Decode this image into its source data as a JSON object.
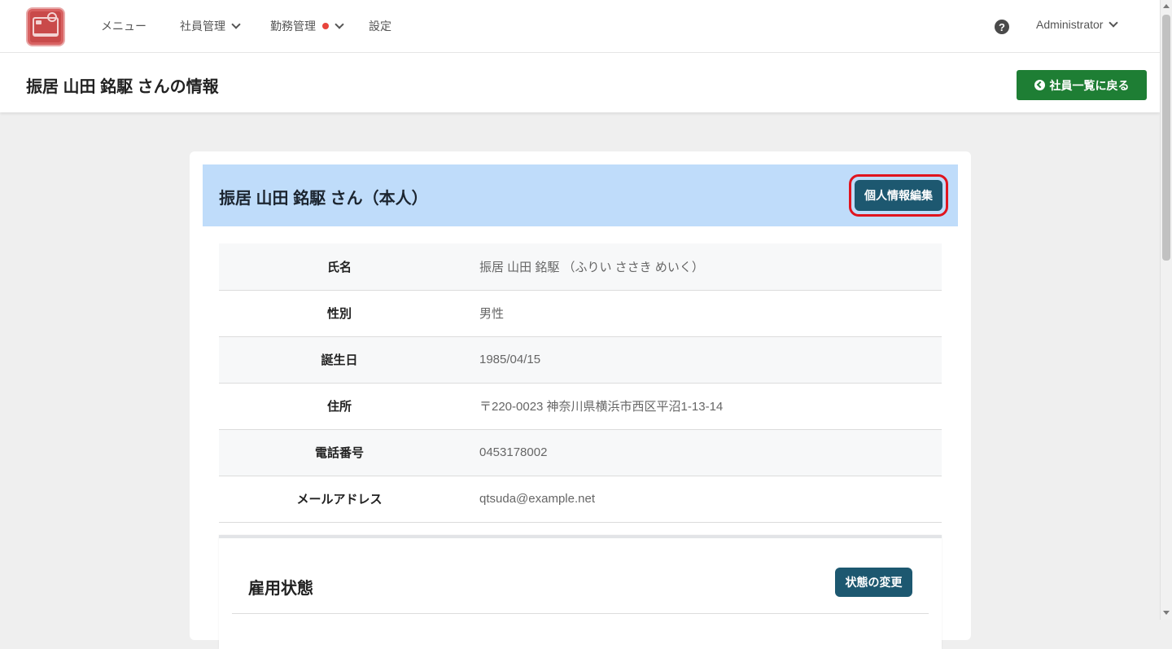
{
  "nav": {
    "logo_name": "app-logo",
    "menu_label": "メニュー",
    "employee_label": "社員管理",
    "attendance_label": "勤務管理",
    "settings_label": "設定",
    "help_glyph": "?",
    "user_label": "Administrator"
  },
  "header": {
    "title": "振居 山田 銘駆 さんの情報",
    "back_button_label": "社員一覧に戻る"
  },
  "card": {
    "title": "振居 山田 銘駆 さん（本人）",
    "edit_button_label": "個人情報編集",
    "rows": [
      {
        "label": "氏名",
        "value": "振居 山田 銘駆 （ふりい ささき めいく）"
      },
      {
        "label": "性別",
        "value": "男性"
      },
      {
        "label": "誕生日",
        "value": "1985/04/15"
      },
      {
        "label": "住所",
        "value": "〒220-0023 神奈川県横浜市西区平沼1-13-14"
      },
      {
        "label": "電話番号",
        "value": "0453178002"
      },
      {
        "label": "メールアドレス",
        "value": "qtsuda@example.net"
      }
    ]
  },
  "employment": {
    "title": "雇用状態",
    "status_button_label": "状態の変更"
  },
  "colors": {
    "accent_green": "#1e7e34",
    "button_teal": "#1d5870",
    "card_head_blue": "#bfdcfa",
    "highlight_red": "#e0141e",
    "alert_dot": "#e8453c"
  }
}
